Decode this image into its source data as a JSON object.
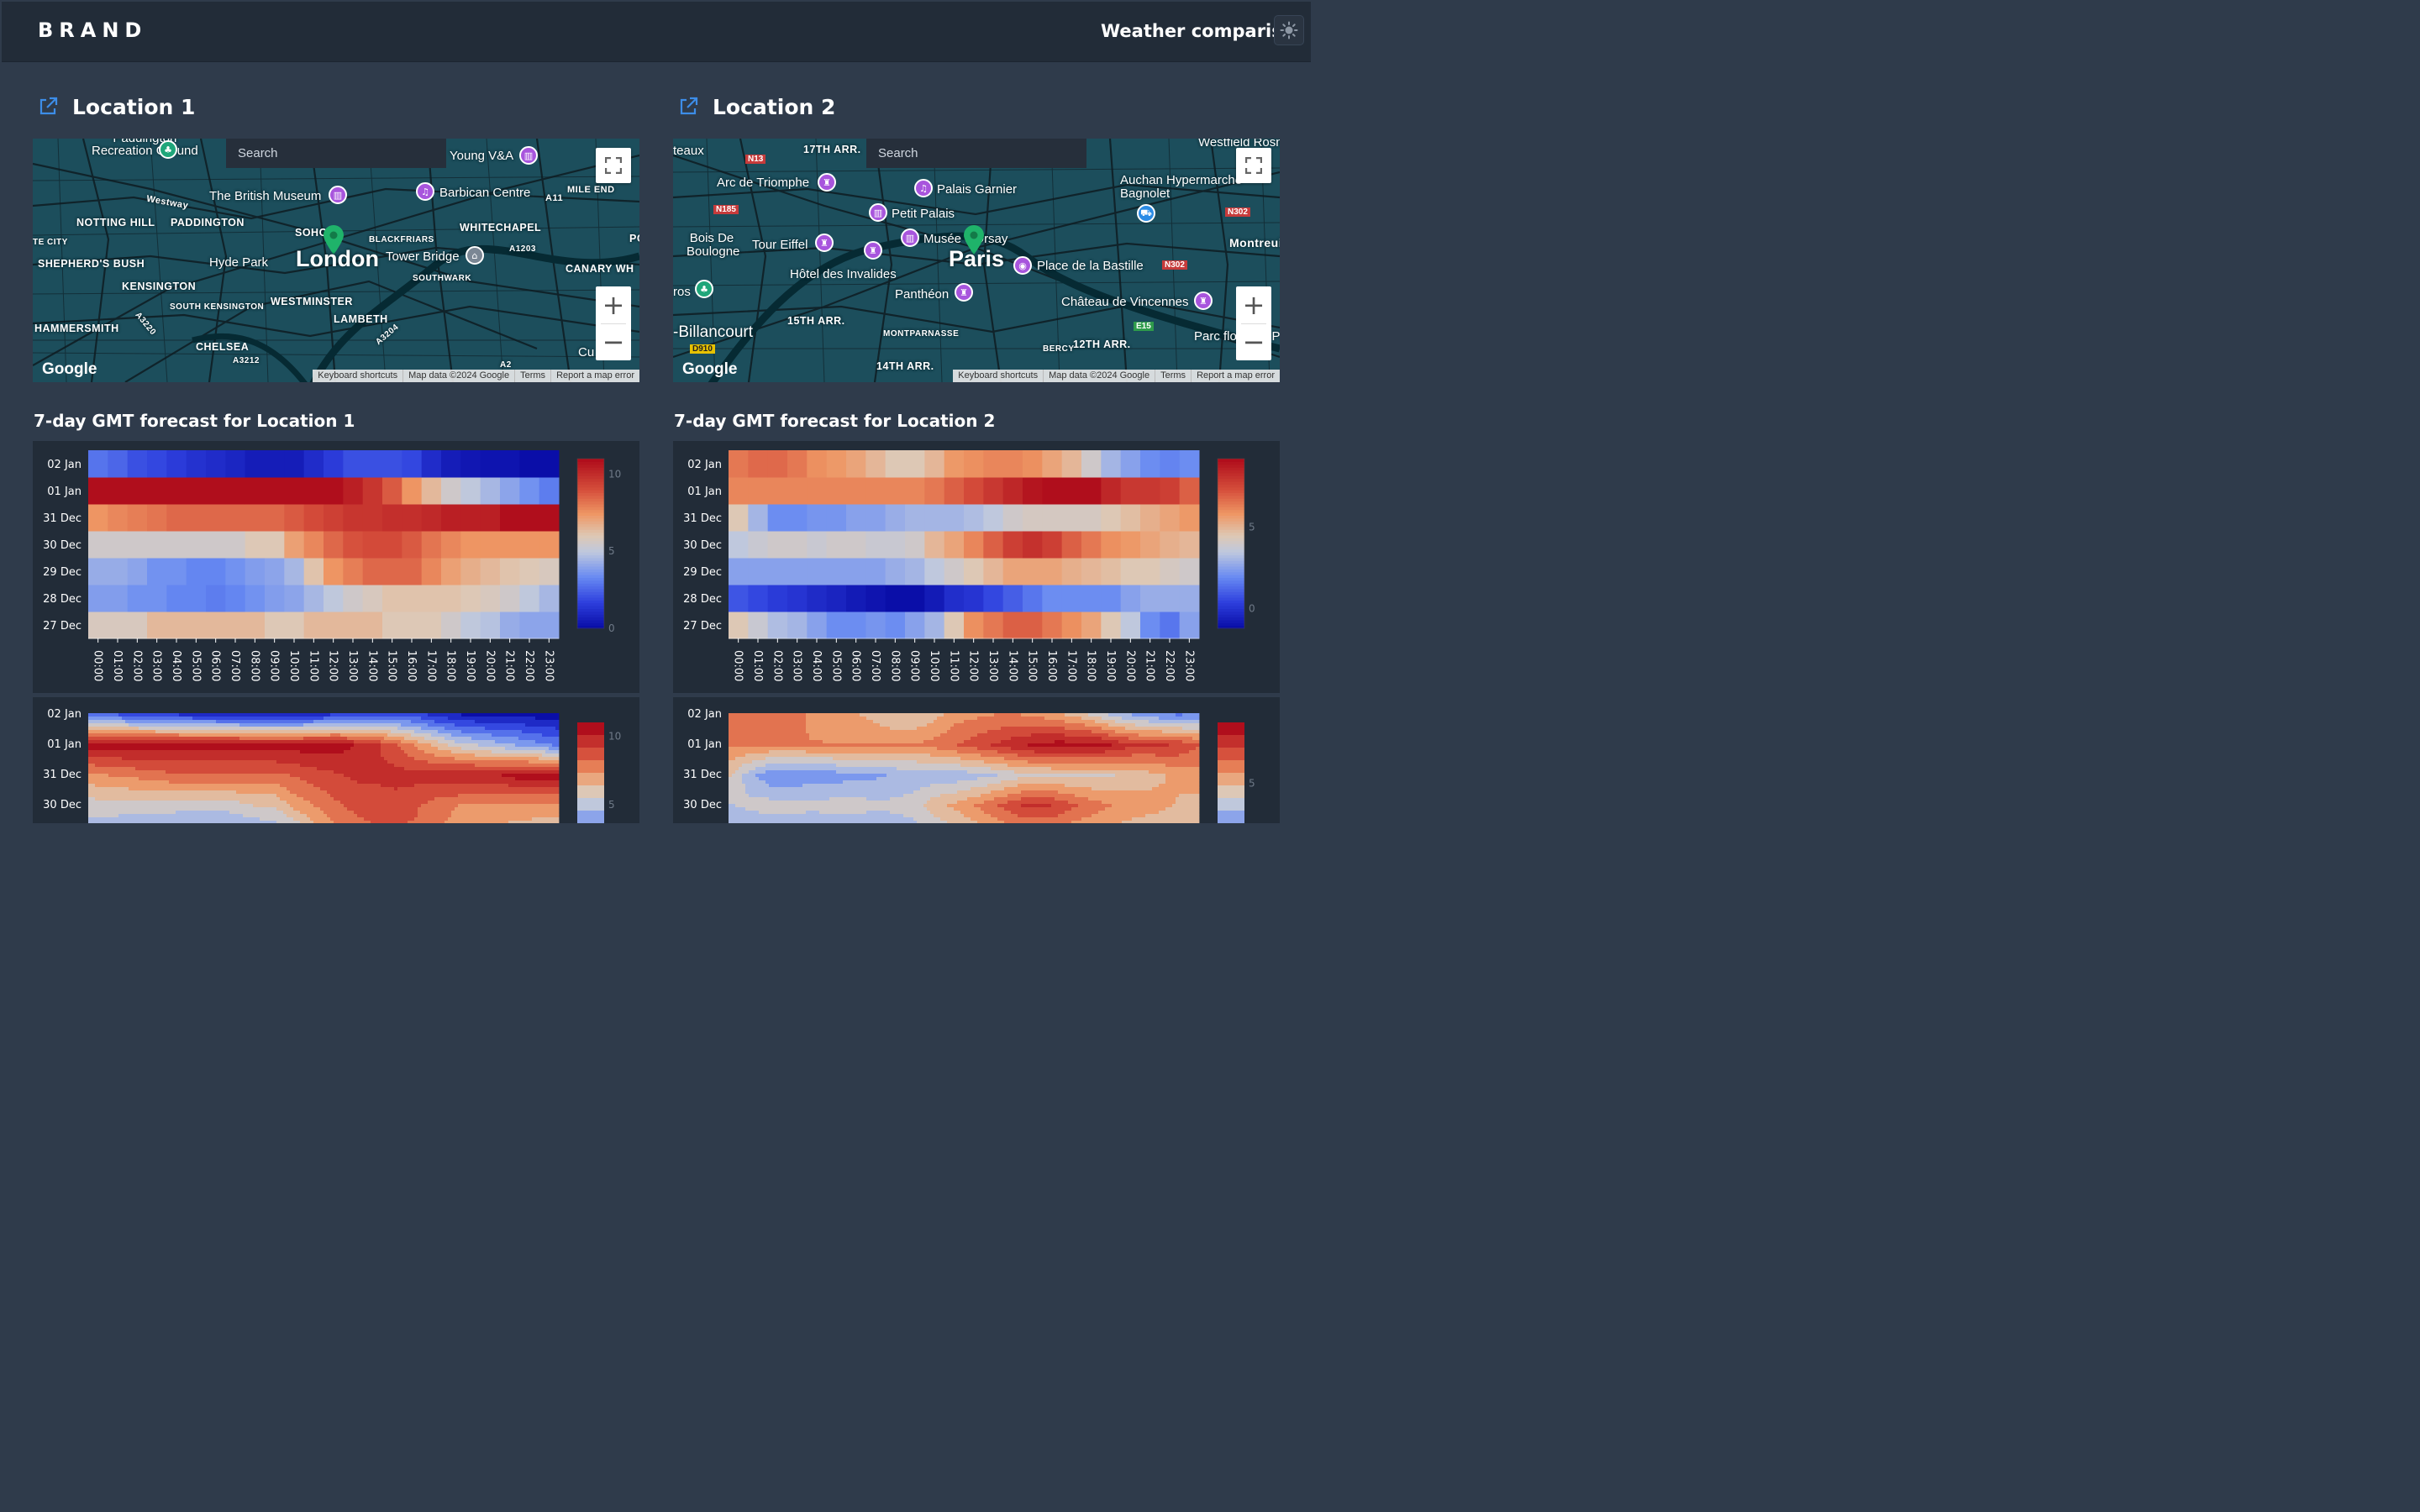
{
  "navbar": {
    "brand": "BRAND",
    "title": "Weather comparison",
    "theme_icon": "sun-icon"
  },
  "locations": [
    {
      "heading": "Location 1",
      "map": {
        "search_placeholder": "Search",
        "city": "London",
        "districts": [
          "NOTTING HILL",
          "PADDINGTON",
          "SOHO",
          "BLACKFRIARS",
          "WHITECHAPEL",
          "SHEPHERD'S BUSH",
          "KENSINGTON",
          "SOUTH KENSINGTON",
          "WESTMINSTER",
          "LAMBETH",
          "SOUTHWARK",
          "HAMMERSMITH",
          "CHELSEA",
          "CANARY WH",
          "TE CITY",
          "MILE END"
        ],
        "places": [
          "Recreation Ground",
          "Young V&A",
          "The British Museum",
          "Barbican Centre",
          "Hyde Park",
          "Tower Bridge",
          "Cu"
        ],
        "roads": [
          "Westway",
          "A11",
          "A1203",
          "A3220",
          "A3212",
          "A3204",
          "A2"
        ],
        "google": "Google",
        "attribution": [
          "Keyboard shortcuts",
          "Map data ©2024 Google",
          "Terms",
          "Report a map error"
        ]
      },
      "forecast_title": "7-day GMT forecast for Location 1"
    },
    {
      "heading": "Location 2",
      "map": {
        "search_placeholder": "Search",
        "city": "Paris",
        "districts": [
          "17TH ARR.",
          "15TH ARR.",
          "MONTPARNASSE",
          "14TH ARR.",
          "BERCY",
          "12TH ARR.",
          "-Billancourt",
          "teaux",
          "Montreuil",
          "Bagnolet"
        ],
        "places": [
          "Arc de Triomphe",
          "Palais Garnier",
          "Petit Palais",
          "Bois De Boulogne",
          "Tour Eiffel",
          "Musée d'Orsay",
          "Place de la Bastille",
          "Hôtel des Invalides",
          "Panthéon",
          "Château de Vincennes",
          "Auchan Hypermarché",
          "Westfield Rosny",
          "Parc floral de Paris",
          "ros"
        ],
        "roads": [
          "N13",
          "N185",
          "N302",
          "N302",
          "E15",
          "D910"
        ],
        "google": "Google",
        "attribution": [
          "Keyboard shortcuts",
          "Map data ©2024 Google",
          "Terms",
          "Report a map error"
        ]
      },
      "forecast_title": "7-day GMT forecast for Location 2"
    }
  ],
  "chart_data": [
    {
      "type": "heatmap",
      "title": "7-day GMT forecast for Location 1",
      "y_categories": [
        "27 Dec",
        "28 Dec",
        "29 Dec",
        "30 Dec",
        "31 Dec",
        "01 Jan",
        "02 Jan"
      ],
      "x_categories": [
        "00:00",
        "01:00",
        "02:00",
        "03:00",
        "04:00",
        "05:00",
        "06:00",
        "07:00",
        "08:00",
        "09:00",
        "10:00",
        "11:00",
        "12:00",
        "13:00",
        "14:00",
        "15:00",
        "16:00",
        "17:00",
        "18:00",
        "19:00",
        "20:00",
        "21:00",
        "22:00",
        "23:00"
      ],
      "z": [
        [
          5.8,
          5.8,
          5.8,
          6.5,
          6.5,
          6.5,
          6.5,
          6.5,
          6.5,
          6.0,
          6.0,
          6.5,
          6.5,
          6.5,
          6.5,
          6.0,
          6.0,
          6.0,
          5.5,
          5.0,
          4.8,
          4.2,
          4.0,
          4.0
        ],
        [
          3.8,
          3.8,
          3.5,
          3.5,
          3.2,
          3.2,
          3.0,
          3.2,
          3.5,
          3.8,
          4.0,
          4.5,
          5.0,
          5.5,
          5.8,
          6.2,
          6.2,
          6.2,
          6.2,
          6.0,
          5.8,
          5.5,
          5.0,
          4.5
        ],
        [
          4.2,
          4.2,
          4.0,
          3.5,
          3.5,
          3.2,
          3.2,
          3.5,
          3.8,
          4.0,
          4.5,
          6.2,
          7.5,
          8.0,
          8.5,
          8.5,
          8.5,
          7.8,
          7.2,
          6.8,
          6.5,
          6.2,
          6.0,
          5.8
        ],
        [
          5.5,
          5.5,
          5.5,
          5.5,
          5.5,
          5.5,
          5.5,
          5.5,
          6.0,
          6.0,
          7.2,
          7.8,
          8.5,
          9.0,
          9.2,
          9.2,
          8.8,
          8.2,
          7.8,
          7.5,
          7.5,
          7.5,
          7.5,
          7.5
        ],
        [
          7.5,
          7.8,
          8.0,
          8.2,
          8.5,
          8.5,
          8.5,
          8.5,
          8.5,
          8.5,
          8.8,
          9.2,
          9.5,
          9.8,
          9.8,
          10.0,
          10.0,
          10.2,
          10.5,
          10.5,
          10.5,
          11.0,
          11.0,
          11.0
        ],
        [
          11.0,
          11.0,
          11.0,
          11.0,
          11.0,
          11.0,
          11.0,
          11.0,
          11.0,
          11.0,
          11.0,
          11.0,
          11.0,
          10.5,
          9.8,
          8.8,
          7.5,
          6.5,
          5.5,
          5.0,
          4.5,
          4.0,
          3.5,
          3.0
        ],
        [
          2.8,
          2.5,
          2.0,
          1.8,
          1.5,
          1.2,
          1.0,
          0.8,
          0.5,
          0.5,
          0.5,
          1.0,
          1.5,
          2.0,
          2.0,
          2.0,
          1.8,
          1.0,
          0.5,
          0.3,
          0.2,
          0.2,
          0.0,
          0.0
        ]
      ],
      "colorbar": {
        "ticks": [
          0,
          5,
          10
        ],
        "range": [
          0,
          11
        ],
        "colorscale": "RdBu (blue-white-red)"
      }
    },
    {
      "type": "heatmap",
      "title": "7-day GMT forecast for Location 2",
      "y_categories": [
        "27 Dec",
        "28 Dec",
        "29 Dec",
        "30 Dec",
        "31 Dec",
        "01 Jan",
        "02 Jan"
      ],
      "x_categories": [
        "00:00",
        "01:00",
        "02:00",
        "03:00",
        "04:00",
        "05:00",
        "06:00",
        "07:00",
        "08:00",
        "09:00",
        "10:00",
        "11:00",
        "12:00",
        "13:00",
        "14:00",
        "15:00",
        "16:00",
        "17:00",
        "18:00",
        "19:00",
        "20:00",
        "21:00",
        "22:00",
        "23:00"
      ],
      "z": [
        [
          4.5,
          3.8,
          3.2,
          3.0,
          2.5,
          2.0,
          2.0,
          2.2,
          2.0,
          2.5,
          3.0,
          4.5,
          6.0,
          6.5,
          7.0,
          7.0,
          6.5,
          6.0,
          5.5,
          4.5,
          3.5,
          2.0,
          1.5,
          2.5
        ],
        [
          0.8,
          0.5,
          0.2,
          0.0,
          -0.3,
          -0.5,
          -0.8,
          -1.0,
          -1.2,
          -1.2,
          -0.8,
          -0.2,
          0.0,
          0.5,
          1.0,
          1.5,
          2.0,
          2.0,
          2.0,
          2.0,
          2.5,
          2.8,
          2.8,
          2.8
        ],
        [
          2.5,
          2.5,
          2.5,
          2.5,
          2.5,
          2.5,
          2.5,
          2.5,
          2.8,
          3.0,
          3.5,
          4.0,
          4.5,
          5.0,
          5.5,
          5.5,
          5.5,
          5.2,
          5.0,
          4.8,
          4.5,
          4.5,
          4.2,
          4.0
        ],
        [
          3.5,
          3.8,
          4.0,
          4.0,
          3.8,
          4.0,
          4.0,
          3.8,
          3.8,
          4.0,
          5.0,
          5.5,
          6.2,
          7.0,
          7.8,
          8.2,
          7.8,
          7.0,
          6.5,
          6.0,
          5.8,
          5.5,
          5.2,
          5.0
        ],
        [
          4.5,
          3.0,
          2.0,
          2.0,
          2.2,
          2.2,
          2.5,
          2.5,
          2.8,
          3.0,
          3.0,
          3.0,
          3.2,
          3.5,
          4.0,
          4.2,
          4.2,
          4.2,
          4.2,
          4.5,
          4.8,
          5.2,
          5.5,
          5.8
        ],
        [
          6.2,
          6.2,
          6.2,
          6.2,
          6.2,
          6.2,
          6.2,
          6.2,
          6.2,
          6.2,
          6.5,
          7.0,
          7.5,
          8.0,
          8.5,
          9.0,
          9.2,
          9.2,
          9.2,
          8.5,
          8.0,
          8.0,
          7.8,
          7.0
        ],
        [
          6.5,
          6.8,
          6.8,
          6.5,
          6.0,
          5.8,
          5.5,
          5.0,
          4.5,
          4.5,
          5.0,
          5.8,
          6.0,
          6.2,
          6.2,
          6.0,
          5.5,
          5.0,
          4.0,
          3.0,
          2.5,
          2.0,
          1.8,
          2.0
        ]
      ],
      "colorbar": {
        "ticks": [
          0,
          5
        ],
        "range": [
          -1.2,
          9.2
        ],
        "colorscale": "RdBu (blue-white-red)"
      }
    },
    {
      "type": "contour",
      "title": "",
      "y_categories_visible": [
        "30 Dec",
        "31 Dec",
        "01 Jan",
        "02 Jan"
      ],
      "source": "same data as Location 1 heatmap",
      "colorbar": {
        "ticks": [
          5,
          10
        ]
      }
    },
    {
      "type": "contour",
      "title": "",
      "y_categories_visible": [
        "30 Dec",
        "31 Dec",
        "01 Jan",
        "02 Jan"
      ],
      "source": "same data as Location 2 heatmap",
      "colorbar": {
        "ticks": [
          5
        ]
      }
    }
  ]
}
